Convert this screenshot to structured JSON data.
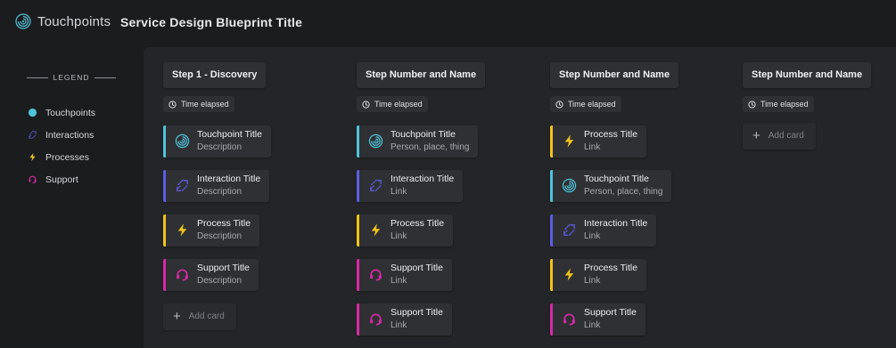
{
  "app": {
    "name": "Touchpoints",
    "title": "Service Design Blueprint Title"
  },
  "colors": {
    "touchpoint": "#4fc3d9",
    "interaction": "#5b5ee0",
    "process": "#f0c419",
    "support": "#d62aa6"
  },
  "legend": {
    "heading": "LEGEND",
    "items": [
      {
        "type": "touchpoint",
        "label": "Touchpoints",
        "icon": "touchpoint-dot-icon"
      },
      {
        "type": "interaction",
        "label": "Interactions",
        "icon": "interaction-icon"
      },
      {
        "type": "process",
        "label": "Processes",
        "icon": "lightning-icon"
      },
      {
        "type": "support",
        "label": "Support",
        "icon": "headset-icon"
      }
    ]
  },
  "columns": [
    {
      "header": "Step 1 - Discovery",
      "time": "Time elapsed",
      "cards": [
        {
          "type": "touchpoint",
          "title": "Touchpoint Title",
          "desc": "Description"
        },
        {
          "type": "interaction",
          "title": "Interaction Title",
          "desc": "Description"
        },
        {
          "type": "process",
          "title": "Process Title",
          "desc": "Description"
        },
        {
          "type": "support",
          "title": "Support Title",
          "desc": "Description"
        }
      ],
      "add_label": "Add card"
    },
    {
      "header": "Step Number and Name",
      "time": "Time elapsed",
      "cards": [
        {
          "type": "touchpoint",
          "title": "Touchpoint Title",
          "desc": "Person, place, thing"
        },
        {
          "type": "interaction",
          "title": "Interaction Title",
          "desc": "Link"
        },
        {
          "type": "process",
          "title": "Process Title",
          "desc": "Link"
        },
        {
          "type": "support",
          "title": "Support Title",
          "desc": "Link"
        },
        {
          "type": "support",
          "title": "Support Title",
          "desc": "Link"
        }
      ],
      "add_label": ""
    },
    {
      "header": "Step Number and Name",
      "time": "Time elapsed",
      "cards": [
        {
          "type": "process",
          "title": "Process Title",
          "desc": "Link"
        },
        {
          "type": "touchpoint",
          "title": "Touchpoint Title",
          "desc": "Person, place, thing"
        },
        {
          "type": "interaction",
          "title": "Interaction Title",
          "desc": "Link"
        },
        {
          "type": "process",
          "title": "Process Title",
          "desc": "Link"
        },
        {
          "type": "support",
          "title": "Support Title",
          "desc": "Link"
        }
      ],
      "add_label": ""
    },
    {
      "header": "Step Number and Name",
      "time": "Time elapsed",
      "cards": [],
      "add_label": "Add card"
    }
  ]
}
